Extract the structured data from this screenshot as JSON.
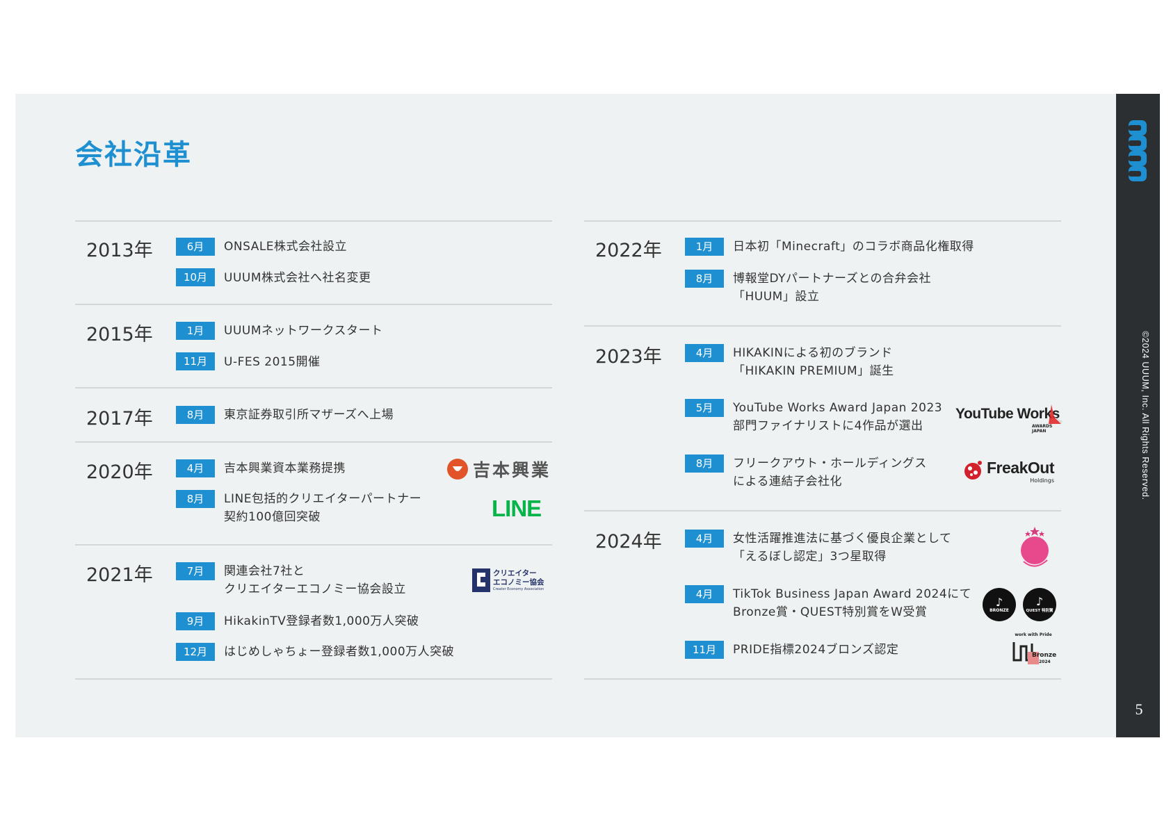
{
  "page": {
    "title": "会社沿革",
    "brand": "UUUM",
    "copyright": "©2024 UUUM, Inc. All Rights Reserved.",
    "page_number": "5"
  },
  "left": [
    {
      "year": "2013年",
      "events": [
        {
          "month": "6月",
          "text": "ONSALE株式会社設立"
        },
        {
          "month": "10月",
          "text": "UUUM株式会社へ社名変更"
        }
      ]
    },
    {
      "year": "2015年",
      "events": [
        {
          "month": "1月",
          "text": "UUUMネットワークスタート"
        },
        {
          "month": "11月",
          "text": "U-FES 2015開催"
        }
      ]
    },
    {
      "year": "2017年",
      "events": [
        {
          "month": "8月",
          "text": "東京証券取引所マザーズへ上場"
        }
      ]
    },
    {
      "year": "2020年",
      "events": [
        {
          "month": "4月",
          "text": "吉本興業資本業務提携"
        },
        {
          "month": "8月",
          "text": "LINE包括的クリエイターパートナー",
          "text2": "契約100億回突破"
        }
      ]
    },
    {
      "year": "2021年",
      "events": [
        {
          "month": "7月",
          "text": "関連会社7社と",
          "text2": "クリエイターエコノミー協会設立"
        },
        {
          "month": "9月",
          "text": "HikakinTV登録者数1,000万人突破"
        },
        {
          "month": "12月",
          "text": "はじめしゃちょー登録者数1,000万人突破"
        }
      ]
    }
  ],
  "right": [
    {
      "year": "2022年",
      "events": [
        {
          "month": "1月",
          "text": "日本初「Minecraft」のコラボ商品化権取得"
        },
        {
          "month": "8月",
          "text": "博報堂DYパートナーズとの合弁会社",
          "text2": "「HUUM」設立"
        }
      ]
    },
    {
      "year": "2023年",
      "events": [
        {
          "month": "4月",
          "text": "HIKAKINによる初のブランド",
          "text2": "「HIKAKIN PREMIUM」誕生"
        },
        {
          "month": "5月",
          "text": "YouTube Works Award Japan 2023",
          "text2": "部門ファイナリストに4作品が選出"
        },
        {
          "month": "8月",
          "text": "フリークアウト・ホールディングス",
          "text2": "による連結子会社化"
        }
      ]
    },
    {
      "year": "2024年",
      "events": [
        {
          "month": "4月",
          "text": "女性活躍推進法に基づく優良企業として",
          "text2": "「えるぼし認定」3つ星取得"
        },
        {
          "month": "4月",
          "text": "TikTok Business Japan Award 2024にて",
          "text2": "Bronze賞・QUEST特別賞をW受賞"
        },
        {
          "month": "11月",
          "text": "PRIDE指標2024ブロンズ認定"
        }
      ]
    }
  ],
  "logos": {
    "yoshimoto": "吉本興業",
    "line": "LINE",
    "cea_line1": "クリエイター",
    "cea_line2": "エコノミー協会",
    "cea_sub": "Creator Economy Association",
    "youtube_works": "YouTube Works",
    "youtube_works_sub": "AWARDS JAPAN",
    "freakout": "FreakOut",
    "freakout_sub": "Holdings",
    "eruboshi_ring": "女性が活躍しています!",
    "tiktok_bronze": "BRONZE",
    "tiktok_quest": "QUEST 特別賞",
    "pride_top": "work with Pride",
    "pride_bronze": "Bronze",
    "pride_year": "2024"
  },
  "colors": {
    "accent": "#1e8fd0",
    "sidebar": "#2b2f31",
    "slide_bg": "#eef2f2"
  }
}
